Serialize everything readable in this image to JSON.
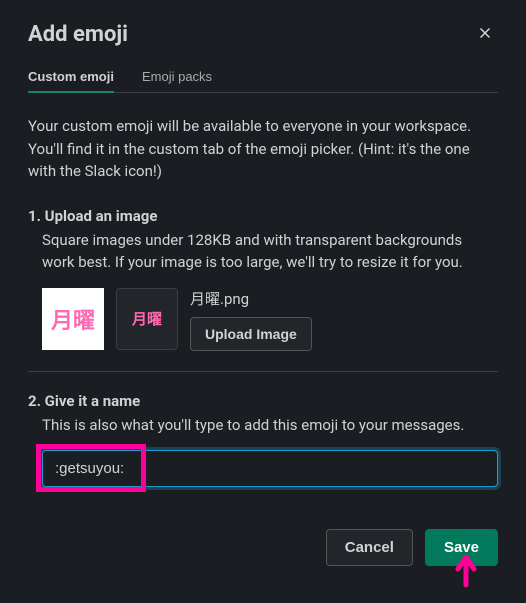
{
  "modal": {
    "title": "Add emoji",
    "tabs": [
      {
        "label": "Custom emoji",
        "active": true
      },
      {
        "label": "Emoji packs",
        "active": false
      }
    ],
    "description": "Your custom emoji will be available to everyone in your workspace. You'll find it in the custom tab of the emoji picker. (Hint: it's the one with the Slack icon!)",
    "step1": {
      "title": "1. Upload an image",
      "desc": "Square images under 128KB and with transparent backgrounds work best. If your image is too large, we'll try to resize it for you.",
      "preview_text": "月曜",
      "filename": "月曜.png",
      "upload_button": "Upload Image"
    },
    "step2": {
      "title": "2. Give it a name",
      "desc": "This is also what you'll type to add this emoji to your messages.",
      "input_value": ":getsuyou:"
    },
    "buttons": {
      "cancel": "Cancel",
      "save": "Save"
    }
  }
}
